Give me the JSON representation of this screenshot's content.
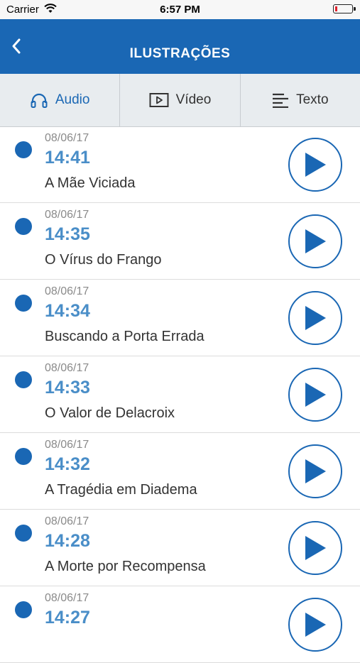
{
  "status": {
    "carrier": "Carrier",
    "time": "6:57 PM"
  },
  "nav": {
    "title": "ILUSTRAÇÕES"
  },
  "tabs": [
    {
      "label": "Audio",
      "icon": "headphones-icon",
      "active": true
    },
    {
      "label": "Vídeo",
      "icon": "video-icon",
      "active": false
    },
    {
      "label": "Texto",
      "icon": "text-lines-icon",
      "active": false
    }
  ],
  "items": [
    {
      "date": "08/06/17",
      "time": "14:41",
      "title": "A Mãe Viciada"
    },
    {
      "date": "08/06/17",
      "time": "14:35",
      "title": "O Vírus do Frango"
    },
    {
      "date": "08/06/17",
      "time": "14:34",
      "title": "Buscando a Porta Errada"
    },
    {
      "date": "08/06/17",
      "time": "14:33",
      "title": "O Valor de Delacroix"
    },
    {
      "date": "08/06/17",
      "time": "14:32",
      "title": "A Tragédia em Diadema"
    },
    {
      "date": "08/06/17",
      "time": "14:28",
      "title": "A Morte por Recompensa"
    },
    {
      "date": "08/06/17",
      "time": "14:27",
      "title": ""
    }
  ],
  "colors": {
    "primary": "#1a67b4",
    "time": "#4a8ec8",
    "tab_bg": "#e8ecef"
  }
}
